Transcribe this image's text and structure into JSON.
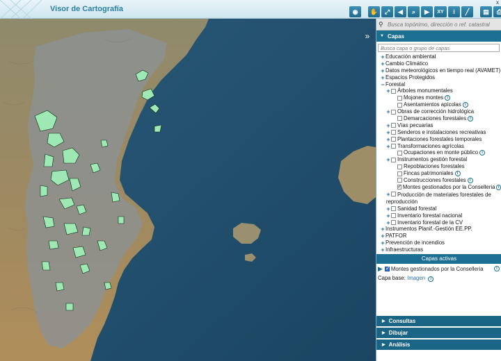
{
  "app": {
    "title": "Visor de Cartografía",
    "close_label": "x"
  },
  "toolbar": [
    {
      "name": "eye-tool",
      "glyph": "◉"
    },
    {
      "name": "pan-tool",
      "glyph": "✋"
    },
    {
      "name": "zoom-extent-tool",
      "glyph": "⤢"
    },
    {
      "name": "back-tool",
      "glyph": "◀"
    },
    {
      "name": "zoom-tool",
      "glyph": "⌕"
    },
    {
      "name": "forward-tool",
      "glyph": "▶"
    },
    {
      "name": "xy-tool",
      "glyph": "XY"
    },
    {
      "name": "info-tool",
      "glyph": "i"
    },
    {
      "name": "measure-tool",
      "glyph": "╱"
    },
    {
      "name": "print-preview-tool",
      "glyph": "▤"
    },
    {
      "name": "print-tool",
      "glyph": "⎙"
    },
    {
      "name": "help-tool",
      "glyph": "?"
    }
  ],
  "search": {
    "placeholder": "Busca topónimo, dirección o ref. catastral"
  },
  "layers_panel": {
    "title": "Capas",
    "search_placeholder": "Busca capa o grupo de capas",
    "items": [
      {
        "label": "Educación ambiental",
        "level": 0,
        "expand": "+",
        "checkbox": false,
        "info": false
      },
      {
        "label": "Cambio Climático",
        "level": 0,
        "expand": "+",
        "checkbox": false,
        "info": false
      },
      {
        "label": "Datos meteorológicos en tiempo real (AVAMET)",
        "level": 0,
        "expand": "+",
        "checkbox": false,
        "info": false
      },
      {
        "label": "Espacios Protegidos",
        "level": 0,
        "expand": "+",
        "checkbox": false,
        "info": false
      },
      {
        "label": "Forestal",
        "level": 0,
        "expand": "−",
        "checkbox": false,
        "info": false
      },
      {
        "label": "Árboles monumentales",
        "level": 1,
        "expand": "+",
        "checkbox": true,
        "info": false
      },
      {
        "label": "Mojones montes",
        "level": 2,
        "expand": "",
        "checkbox": true,
        "info": true
      },
      {
        "label": "Asentamientos apícolas",
        "level": 2,
        "expand": "",
        "checkbox": true,
        "info": true
      },
      {
        "label": "Obras de corrección hidrológica",
        "level": 1,
        "expand": "+",
        "checkbox": true,
        "info": false
      },
      {
        "label": "Demarcaciones forestales",
        "level": 2,
        "expand": "",
        "checkbox": true,
        "info": true
      },
      {
        "label": "Vías pecuarias",
        "level": 1,
        "expand": "+",
        "checkbox": true,
        "info": false
      },
      {
        "label": "Senderos e instalaciones recreativas",
        "level": 1,
        "expand": "+",
        "checkbox": true,
        "info": false
      },
      {
        "label": "Plantaciones forestales temporales",
        "level": 1,
        "expand": "+",
        "checkbox": true,
        "info": false
      },
      {
        "label": "Transformaciones agrícolas",
        "level": 1,
        "expand": "+",
        "checkbox": true,
        "info": false
      },
      {
        "label": "Ocupaciones en monte público",
        "level": 2,
        "expand": "",
        "checkbox": true,
        "info": true
      },
      {
        "label": "Instrumentos gestión forestal",
        "level": 1,
        "expand": "+",
        "checkbox": true,
        "info": false
      },
      {
        "label": "Repoblaciones forestales",
        "level": 2,
        "expand": "",
        "checkbox": true,
        "info": false
      },
      {
        "label": "Fincas patrimoniales",
        "level": 2,
        "expand": "",
        "checkbox": true,
        "info": true
      },
      {
        "label": "Construcciones forestales",
        "level": 2,
        "expand": "",
        "checkbox": true,
        "info": true
      },
      {
        "label": "Montes gestionados por la Conselleria",
        "level": 2,
        "expand": "",
        "checkbox": "checked",
        "info": true
      },
      {
        "label": "Producción de materiales forestales de reproducción",
        "level": 1,
        "expand": "+",
        "checkbox": true,
        "info": false,
        "wrap": true
      },
      {
        "label": "Sanidad forestal",
        "level": 1,
        "expand": "+",
        "checkbox": true,
        "info": false
      },
      {
        "label": "Inventario forestal nacional",
        "level": 1,
        "expand": "+",
        "checkbox": true,
        "info": false
      },
      {
        "label": "Inventario forestal de la CV",
        "level": 1,
        "expand": "+",
        "checkbox": true,
        "info": false
      },
      {
        "label": "Instrumentos Planif.-Gestión EE.PP.",
        "level": 0,
        "expand": "+",
        "checkbox": false,
        "info": false
      },
      {
        "label": "PATFOR",
        "level": 0,
        "expand": "+",
        "checkbox": false,
        "info": false
      },
      {
        "label": "Prevención de incendios",
        "level": 0,
        "expand": "+",
        "checkbox": false,
        "info": false
      },
      {
        "label": "Infraestructuras",
        "level": 0,
        "expand": "+",
        "checkbox": false,
        "info": false
      }
    ]
  },
  "active_layers": {
    "title": "Capas activas",
    "items": [
      {
        "label": "Montes gestionados por la Conselleria",
        "checked": true
      }
    ],
    "basemap_label": "Capa base:",
    "basemap_value": "Imagen"
  },
  "bottom_sections": [
    "Consultas",
    "Dibujar",
    "Análisis"
  ],
  "colors": {
    "accent": "#1c6f93",
    "sea": "#1e4a66",
    "land": "#9a8c70",
    "forest_polygons": "#9ee8b4"
  }
}
